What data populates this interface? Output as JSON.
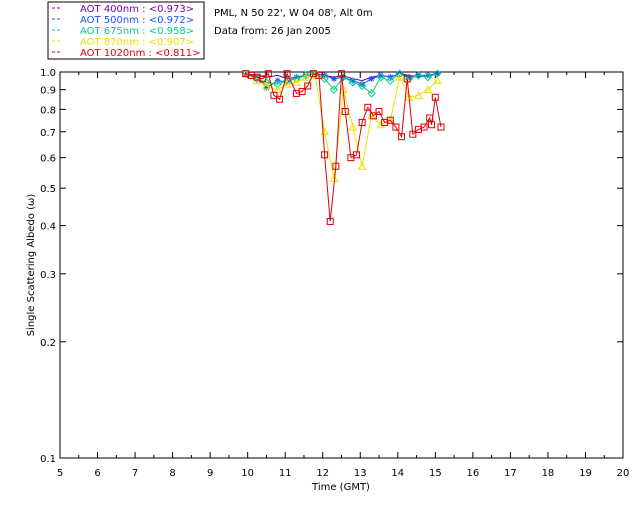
{
  "header": {
    "site_line": "PML, N 50 22', W 04 08', Alt 0m",
    "date_line": "Data from: 26 Jan 2005"
  },
  "chart_data": {
    "type": "line",
    "xlabel": "Time (GMT)",
    "ylabel": "Single Scattering Albedo (ω)",
    "xlim": [
      5,
      20
    ],
    "ylim": [
      0.1,
      1.0
    ],
    "yscale": "log",
    "grid": false,
    "legend_position": "top-left",
    "x_ticks": [
      5,
      6,
      7,
      8,
      9,
      10,
      11,
      12,
      13,
      14,
      15,
      16,
      17,
      18,
      19,
      20
    ],
    "y_ticks": [
      0.1,
      0.2,
      0.3,
      0.4,
      0.5,
      0.6,
      0.7,
      0.8,
      0.9,
      1.0
    ],
    "series": [
      {
        "name": "AOT  400nm : <0.973>",
        "color": "#7a00b0",
        "marker": "none",
        "x": [
          9.95,
          10.25,
          10.5,
          10.8,
          11.05,
          11.3,
          11.55,
          11.8,
          12.05,
          12.3,
          12.55,
          12.8,
          13.05,
          13.3,
          13.55,
          13.8,
          14.05,
          14.3,
          14.55,
          14.8,
          15.05
        ],
        "y": [
          0.99,
          0.98,
          0.97,
          0.98,
          0.96,
          0.97,
          0.98,
          0.99,
          0.98,
          0.97,
          0.98,
          0.96,
          0.95,
          0.97,
          0.98,
          0.97,
          0.99,
          0.98,
          0.97,
          0.98,
          0.99
        ]
      },
      {
        "name": "AOT  500nm : <0.972>",
        "color": "#1e50ff",
        "marker": "asterisk",
        "x": [
          9.95,
          10.25,
          10.5,
          10.8,
          11.05,
          11.3,
          11.55,
          11.8,
          12.05,
          12.3,
          12.55,
          12.8,
          13.05,
          13.3,
          13.55,
          13.8,
          14.05,
          14.3,
          14.55,
          14.8,
          15.05
        ],
        "y": [
          0.99,
          0.97,
          0.91,
          0.95,
          0.94,
          0.97,
          0.98,
          0.99,
          0.98,
          0.96,
          0.97,
          0.95,
          0.93,
          0.96,
          0.98,
          0.97,
          0.99,
          0.97,
          0.98,
          0.98,
          0.99
        ]
      },
      {
        "name": "AOT  675nm : <0.958>",
        "color": "#00d090",
        "marker": "diamond",
        "x": [
          9.95,
          10.25,
          10.5,
          10.8,
          11.05,
          11.3,
          11.55,
          11.8,
          12.05,
          12.3,
          12.55,
          12.8,
          13.05,
          13.3,
          13.55,
          13.8,
          14.05,
          14.3,
          14.55,
          14.8,
          15.05
        ],
        "y": [
          0.99,
          0.96,
          0.94,
          0.93,
          0.95,
          0.96,
          0.98,
          0.99,
          0.96,
          0.9,
          0.97,
          0.94,
          0.92,
          0.88,
          0.97,
          0.95,
          0.99,
          0.96,
          0.98,
          0.97,
          0.99
        ]
      },
      {
        "name": "AOT  870nm : <0.907>",
        "color": "#f0e000",
        "marker": "triangle",
        "x": [
          9.95,
          10.25,
          10.5,
          10.8,
          11.05,
          11.3,
          11.55,
          11.8,
          12.05,
          12.3,
          12.55,
          12.8,
          13.05,
          13.3,
          13.55,
          13.8,
          14.05,
          14.3,
          14.55,
          14.8,
          15.05
        ],
        "y": [
          0.99,
          0.95,
          0.92,
          0.9,
          0.93,
          0.94,
          0.97,
          0.98,
          0.7,
          0.53,
          0.9,
          0.72,
          0.57,
          0.77,
          0.73,
          0.75,
          0.97,
          0.86,
          0.87,
          0.9,
          0.95
        ]
      },
      {
        "name": "AOT 1020nm : <0.811>",
        "color": "#e00000",
        "marker": "square",
        "x": [
          9.95,
          10.1,
          10.25,
          10.4,
          10.55,
          10.7,
          10.85,
          11.05,
          11.3,
          11.45,
          11.6,
          11.75,
          11.9,
          12.05,
          12.2,
          12.35,
          12.5,
          12.6,
          12.75,
          12.9,
          13.05,
          13.2,
          13.35,
          13.5,
          13.65,
          13.8,
          13.95,
          14.1,
          14.25,
          14.4,
          14.55,
          14.7,
          14.85,
          14.9,
          15.0,
          15.15
        ],
        "y": [
          0.99,
          0.98,
          0.97,
          0.96,
          0.99,
          0.87,
          0.85,
          0.99,
          0.88,
          0.89,
          0.92,
          0.99,
          0.98,
          0.61,
          0.41,
          0.57,
          0.99,
          0.79,
          0.6,
          0.61,
          0.74,
          0.81,
          0.77,
          0.79,
          0.74,
          0.75,
          0.72,
          0.68,
          0.96,
          0.69,
          0.71,
          0.72,
          0.76,
          0.73,
          0.86,
          0.72
        ]
      }
    ]
  }
}
